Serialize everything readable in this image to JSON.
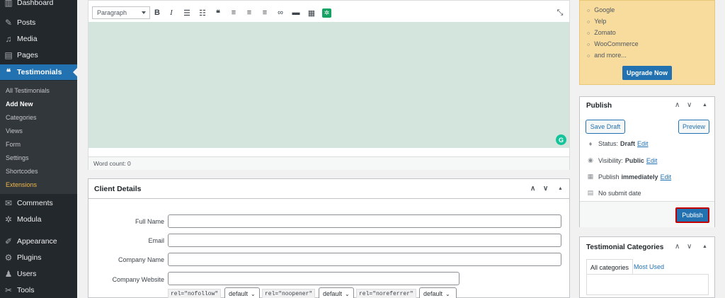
{
  "sidebar": {
    "items": [
      {
        "label": "Dashboard",
        "icon": "dashboard-icon",
        "glyph": "▥"
      },
      {
        "label": "Posts",
        "icon": "pin-icon",
        "glyph": "✎"
      },
      {
        "label": "Media",
        "icon": "media-icon",
        "glyph": "♫"
      },
      {
        "label": "Pages",
        "icon": "pages-icon",
        "glyph": "▤"
      },
      {
        "label": "Testimonials",
        "icon": "quote-icon",
        "glyph": "❝"
      }
    ],
    "submenu": [
      "All Testimonials",
      "Add New",
      "Categories",
      "Views",
      "Form",
      "Settings",
      "Shortcodes",
      "Extensions"
    ],
    "bottom_items": [
      {
        "label": "Comments",
        "icon": "comments-icon",
        "glyph": "✉"
      },
      {
        "label": "Modula",
        "icon": "modula-icon",
        "glyph": "✲"
      },
      {
        "label": "Appearance",
        "icon": "brush-icon",
        "glyph": "✐"
      },
      {
        "label": "Plugins",
        "icon": "plugin-icon",
        "glyph": "⚙"
      },
      {
        "label": "Users",
        "icon": "users-icon",
        "glyph": "♟"
      },
      {
        "label": "Tools",
        "icon": "tools-icon",
        "glyph": "✂"
      }
    ]
  },
  "editor": {
    "format_select": "Paragraph",
    "word_count": "Word count: 0"
  },
  "client_details": {
    "title": "Client Details",
    "fields": {
      "full_name": "Full Name",
      "email": "Email",
      "company_name": "Company Name",
      "company_website": "Company Website"
    },
    "rel": {
      "nofollow": "rel=\"nofollow\"",
      "noopener": "rel=\"noopener\"",
      "noreferrer": "rel=\"noreferrer\"",
      "default": "default"
    }
  },
  "promo": {
    "items": [
      "Google",
      "Yelp",
      "Zomato",
      "WooCommerce",
      "and more..."
    ],
    "button": "Upgrade Now"
  },
  "publish": {
    "title": "Publish",
    "save_draft": "Save Draft",
    "preview": "Preview",
    "status_label": "Status:",
    "status_value": "Draft",
    "visibility_label": "Visibility:",
    "visibility_value": "Public",
    "publish_label": "Publish",
    "publish_value": "immediately",
    "edit": "Edit",
    "no_submit": "No submit date",
    "publish_button": "Publish"
  },
  "categories": {
    "title": "Testimonial Categories",
    "tab_all": "All categories",
    "tab_used": "Most Used"
  },
  "colors": {
    "sidebar_bg": "#23282d",
    "accent": "#2271b1",
    "editor_bg": "#d4e5de",
    "promo_bg": "#f7dc9e",
    "publish_outline": "#c40000"
  }
}
